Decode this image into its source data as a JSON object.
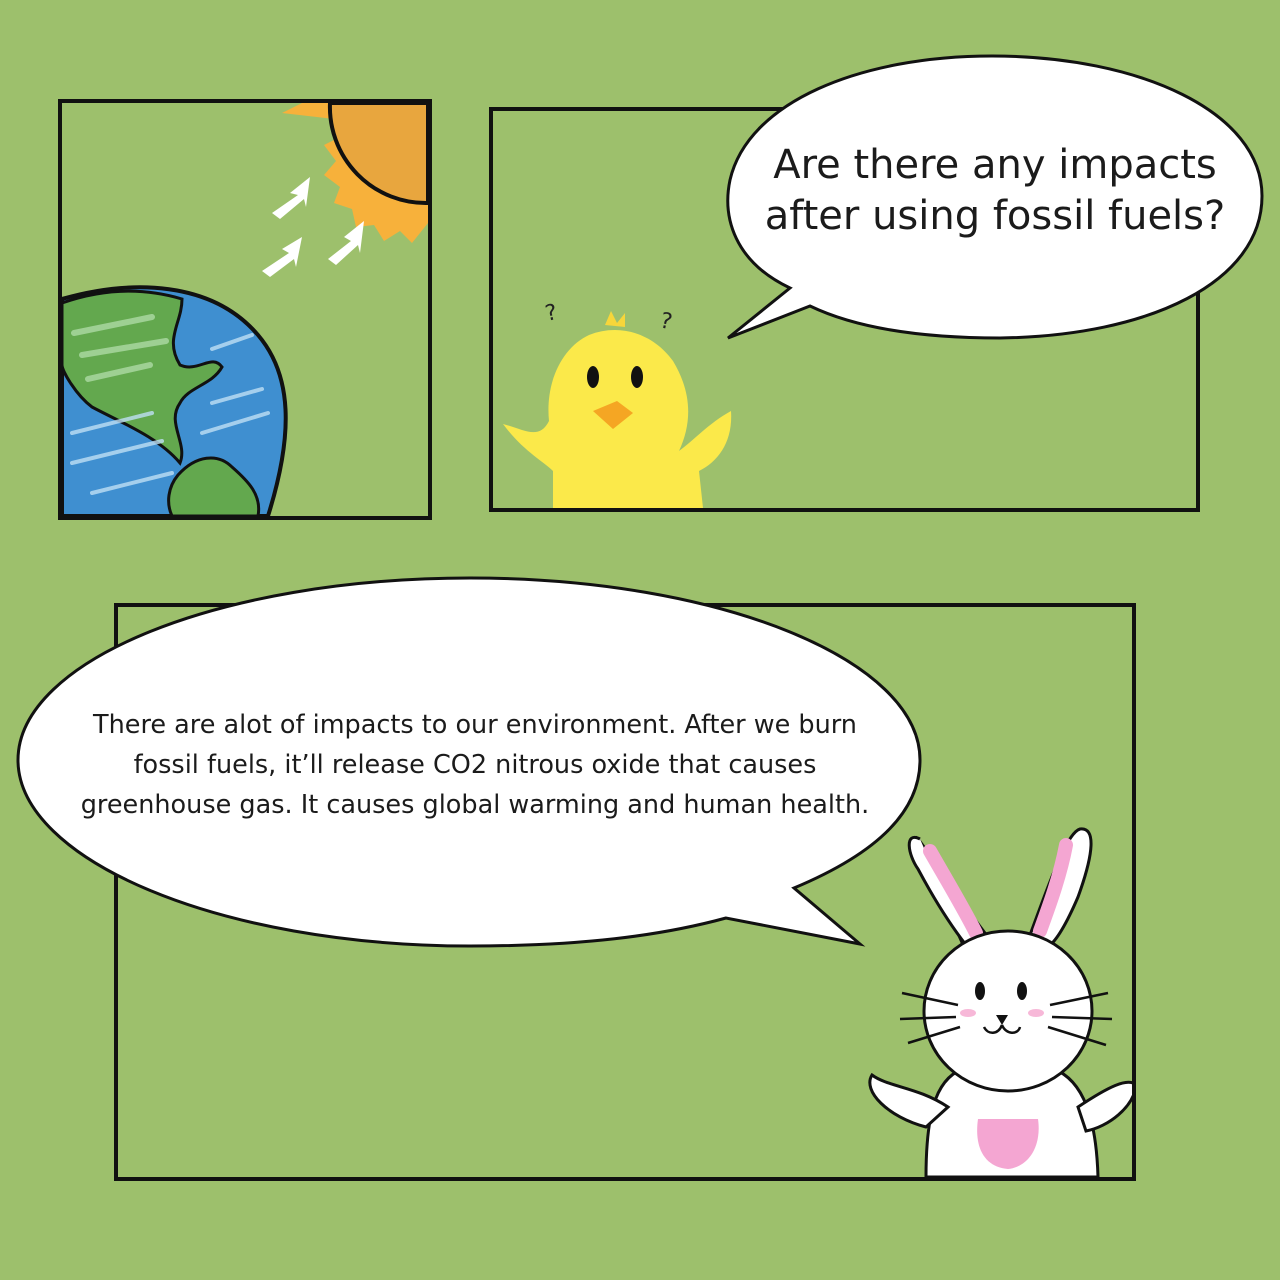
{
  "colors": {
    "background": "#9dc06c",
    "sun": "#f2a93b",
    "ocean": "#3f8fd0",
    "land": "#5fa24b",
    "chick": "#fbe94a",
    "bunny_pink": "#f4a6d2"
  },
  "panels": [
    {
      "name": "earth-and-sun",
      "icons": [
        "sun-icon",
        "earth-icon",
        "sun-ray-arrow-icon"
      ]
    },
    {
      "name": "chick-question",
      "icons": [
        "chick-icon",
        "question-mark-icon"
      ]
    },
    {
      "name": "bunny-answer",
      "icons": [
        "bunny-icon"
      ]
    }
  ],
  "chick_bubble": {
    "line1": "Are there any impacts",
    "line2": "after using fossil fuels?"
  },
  "bunny_bubble": {
    "line1": "There are alot of impacts to our environment. After we burn",
    "line2": "fossil fuels, it’ll release CO2 nitrous oxide that causes",
    "line3": "greenhouse gas. It causes global warming and human health."
  },
  "chick_marks": {
    "q1": "?",
    "q2": "?"
  }
}
